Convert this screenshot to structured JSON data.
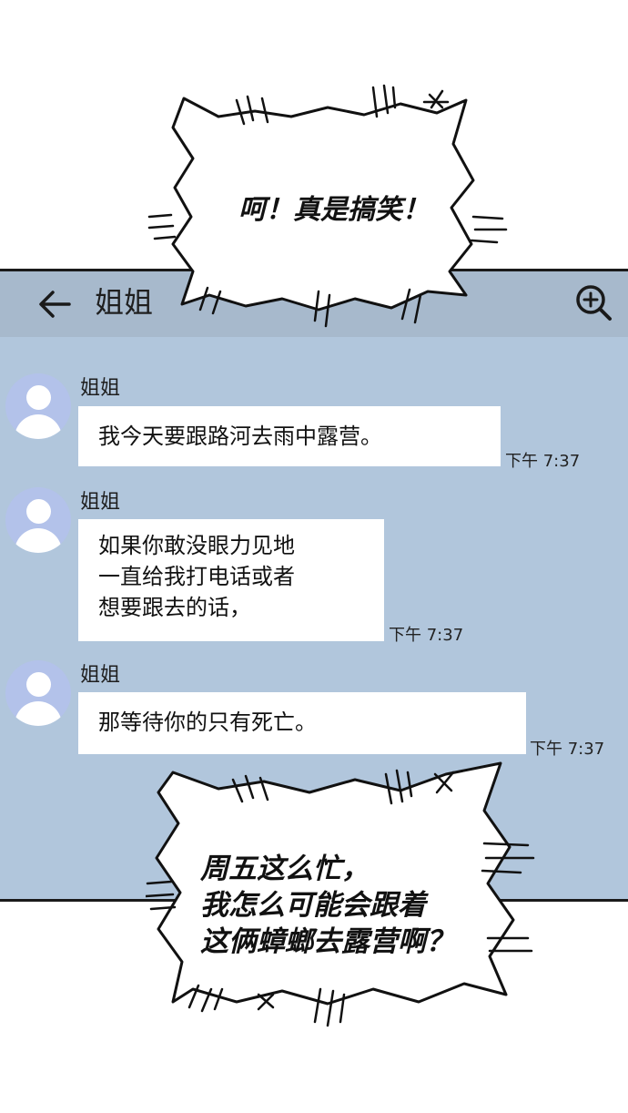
{
  "header": {
    "title": "姐姐",
    "back_icon": "arrow-left-icon",
    "zoom_icon": "zoom-in-icon"
  },
  "bubbles_top": {
    "text": "呵！真是搞笑！"
  },
  "messages": [
    {
      "sender": "姐姐",
      "lines": [
        "我今天要跟路河去雨中露营。"
      ],
      "time": "下午 7:37"
    },
    {
      "sender": "姐姐",
      "lines": [
        "如果你敢没眼力见地",
        "一直给我打电话或者",
        "想要跟去的话，"
      ],
      "time": "下午 7:37"
    },
    {
      "sender": "姐姐",
      "lines": [
        "那等待你的只有死亡。"
      ],
      "time": "下午 7:37"
    }
  ],
  "bubble_bottom": {
    "lines": [
      "周五这么忙，",
      "我怎么可能会跟着",
      "这俩蟑螂去露营啊？"
    ]
  },
  "colors": {
    "panel": "#b1c6dc",
    "topbar": "#a7b9cc",
    "avatar": "#b3c2ea"
  }
}
